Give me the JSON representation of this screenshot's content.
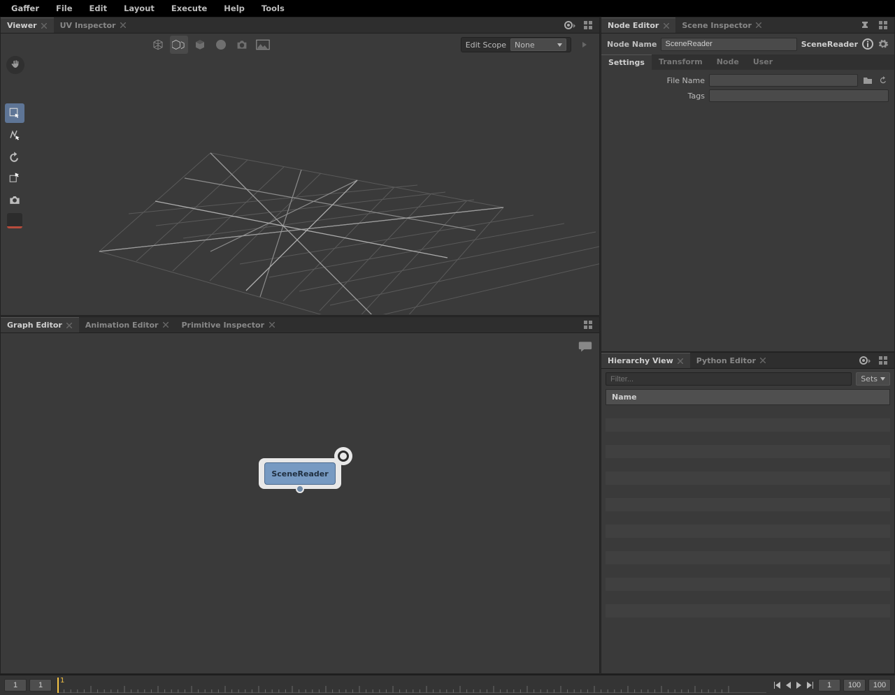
{
  "menubar": [
    "Gaffer",
    "File",
    "Edit",
    "Layout",
    "Execute",
    "Help",
    "Tools"
  ],
  "viewer": {
    "tabs": [
      {
        "label": "Viewer",
        "active": true
      },
      {
        "label": "UV Inspector",
        "active": false
      }
    ],
    "editscope_label": "Edit Scope",
    "editscope_value": "None"
  },
  "graph": {
    "tabs": [
      {
        "label": "Graph Editor",
        "active": true
      },
      {
        "label": "Animation Editor",
        "active": false
      },
      {
        "label": "Primitive Inspector",
        "active": false
      }
    ],
    "node_label": "SceneReader"
  },
  "node_editor": {
    "tabs": [
      {
        "label": "Node Editor",
        "active": true
      },
      {
        "label": "Scene Inspector",
        "active": false
      }
    ],
    "name_label": "Node Name",
    "name_value": "SceneReader",
    "type_label": "SceneReader",
    "section_tabs": [
      {
        "label": "Settings",
        "active": true
      },
      {
        "label": "Transform",
        "active": false
      },
      {
        "label": "Node",
        "active": false
      },
      {
        "label": "User",
        "active": false
      }
    ],
    "rows": {
      "filename_label": "File Name",
      "filename_value": "",
      "tags_label": "Tags",
      "tags_value": ""
    }
  },
  "hierarchy": {
    "tabs": [
      {
        "label": "Hierarchy View",
        "active": true
      },
      {
        "label": "Python Editor",
        "active": false
      }
    ],
    "filter_placeholder": "Filter...",
    "sets_label": "Sets",
    "header": "Name"
  },
  "timeline": {
    "start": "1",
    "range_start": "1",
    "current": "1",
    "range_end": "100",
    "end": "100"
  }
}
